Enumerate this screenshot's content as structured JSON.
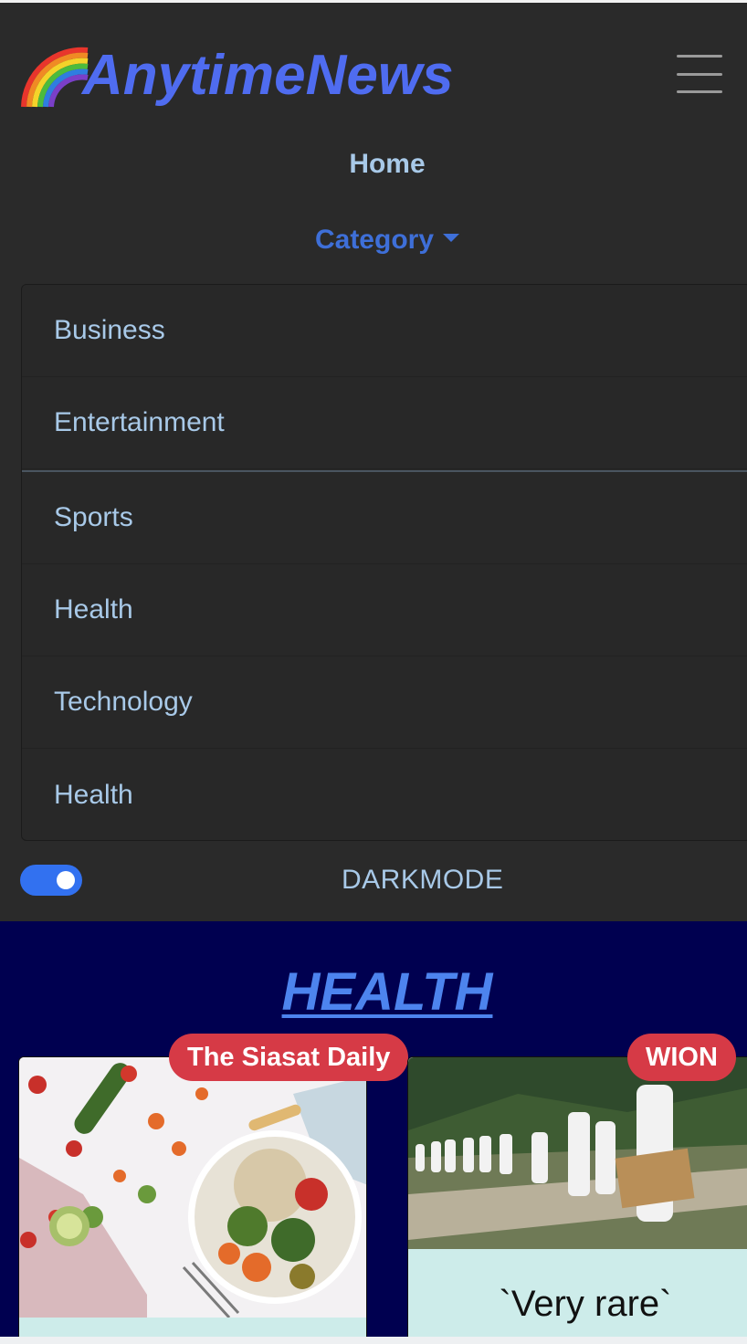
{
  "brand": {
    "name": "AnytimeNews",
    "logo_icon": "rainbow-icon",
    "color": "#4f6cf0"
  },
  "nav": {
    "home_label": "Home",
    "category_label": "Category",
    "toggler_icon": "hamburger-icon"
  },
  "category_menu": {
    "items": [
      {
        "label": "Business"
      },
      {
        "label": "Entertainment"
      },
      {
        "label": "Sports"
      },
      {
        "label": "Health"
      },
      {
        "label": "Technology"
      },
      {
        "label": "Health"
      }
    ]
  },
  "dark_mode": {
    "label": "DARKMODE",
    "enabled": true,
    "accent": "#3271f0"
  },
  "main": {
    "section_title": "HEALTH",
    "background": "#000050",
    "cards": [
      {
        "source": "The Siasat Daily",
        "image": "healthy-food-bowl-image",
        "title": ""
      },
      {
        "source": "WION",
        "image": "workers-in-protective-suits-image",
        "title": "`Very rare`"
      }
    ]
  },
  "colors": {
    "navbar_bg": "#2a2a2a",
    "link": "#a8c9e8",
    "active_link": "#3e6fd8",
    "badge": "#d63a46",
    "card_body": "#cdecea"
  }
}
